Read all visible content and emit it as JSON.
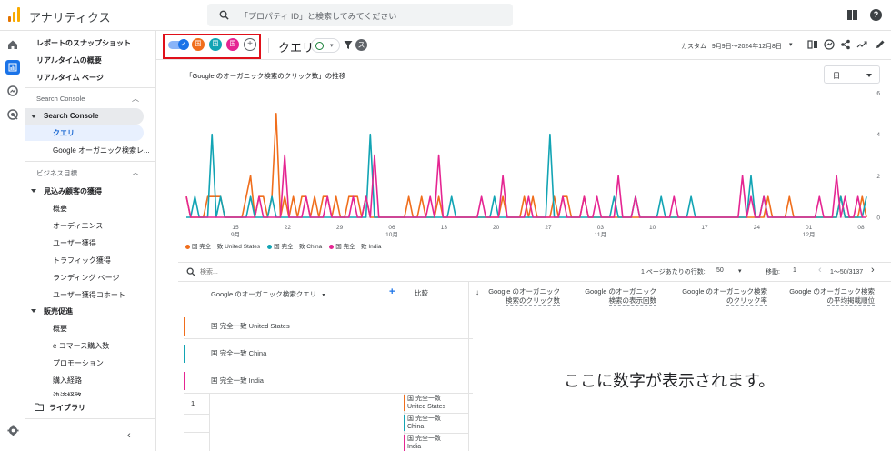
{
  "app": {
    "title": "アナリティクス"
  },
  "search": {
    "placeholder": "「プロパティ ID」と検索してみてください"
  },
  "nav": {
    "top_items": [
      "レポートのスナップショット",
      "リアルタイムの概要",
      "リアルタイム ページ"
    ],
    "section_search_console": "Search Console",
    "search_console_group": "Search Console",
    "search_console_children": [
      "クエリ",
      "Google オーガニック検索レ..."
    ],
    "section_business": "ビジネス目標",
    "acquisition_group": "見込み顧客の獲得",
    "acquisition_children": [
      "概要",
      "オーディエンス",
      "ユーザー獲得",
      "トラフィック獲得",
      "ランディング ページ",
      "ユーザー獲得コホート"
    ],
    "sales_group": "販売促進",
    "sales_children": [
      "概要",
      "e コマース購入数",
      "プロモーション",
      "購入経路",
      "決済経路"
    ],
    "library": "ライブラリ"
  },
  "toolbar": {
    "chips": [
      {
        "label": "国",
        "color": "#f06e1c"
      },
      {
        "label": "国",
        "color": "#12a4b4"
      },
      {
        "label": "国",
        "color": "#e52592"
      }
    ],
    "add": "+",
    "report_title": "クエリ",
    "s_badge": "ス",
    "date_prefix": "カスタム",
    "date_range": "9月9日～2024年12月8日"
  },
  "chart": {
    "title": "「Google のオーガニック検索のクリック数」の推移",
    "granularity": "日"
  },
  "chart_data": {
    "type": "line",
    "title": "「Google のオーガニック検索のクリック数」の推移",
    "ylim": [
      0,
      6
    ],
    "y_ticks": [
      "0",
      "2",
      "4",
      "6"
    ],
    "x_ticks": [
      {
        "day": "15",
        "month": "9月"
      },
      {
        "day": "22",
        "month": ""
      },
      {
        "day": "29",
        "month": ""
      },
      {
        "day": "06",
        "month": "10月"
      },
      {
        "day": "13",
        "month": ""
      },
      {
        "day": "20",
        "month": ""
      },
      {
        "day": "27",
        "month": ""
      },
      {
        "day": "03",
        "month": "11月"
      },
      {
        "day": "10",
        "month": ""
      },
      {
        "day": "17",
        "month": ""
      },
      {
        "day": "24",
        "month": ""
      },
      {
        "day": "01",
        "month": "12月"
      },
      {
        "day": "08",
        "month": ""
      }
    ],
    "series": [
      {
        "name": "国 完全一致 United States",
        "color": "#f06e1c",
        "values": [
          1,
          0,
          0,
          0,
          0,
          1,
          1,
          1,
          1,
          0,
          0,
          0,
          0,
          0,
          1,
          2,
          0,
          1,
          1,
          0,
          1,
          5,
          0,
          1,
          0,
          1,
          0,
          1,
          1,
          0,
          1,
          0,
          1,
          1,
          0,
          1,
          0,
          0,
          1,
          1,
          1,
          0,
          1,
          0,
          0,
          0,
          0,
          0,
          0,
          0,
          0,
          0,
          1,
          0,
          0,
          1,
          0,
          0,
          0,
          1,
          0,
          0,
          0,
          0,
          0,
          0,
          0,
          0,
          0,
          0,
          0,
          0,
          0,
          0,
          1,
          0,
          0,
          0,
          0,
          1,
          0,
          1,
          0,
          0,
          0,
          0,
          1,
          0,
          1,
          1,
          0,
          0,
          0,
          1,
          0,
          0,
          0,
          0,
          0,
          0,
          0,
          0,
          0,
          0,
          0,
          0,
          0,
          0,
          0,
          0,
          0,
          0,
          0,
          0,
          0,
          0,
          0,
          0,
          0,
          0,
          0,
          0,
          0,
          0,
          0,
          0,
          0,
          0,
          0,
          0,
          0,
          0,
          0,
          0,
          0,
          0,
          1,
          0,
          0,
          0,
          0,
          1,
          0,
          0,
          0,
          0,
          0,
          0,
          0,
          0,
          0,
          0,
          0,
          1,
          0,
          0,
          0,
          0,
          1,
          0
        ]
      },
      {
        "name": "国 完全一致 China",
        "color": "#12a4b4",
        "values": [
          0,
          0,
          1,
          0,
          0,
          0,
          4,
          0,
          1,
          0,
          0,
          0,
          0,
          0,
          0,
          1,
          0,
          0,
          0,
          0,
          1,
          0,
          0,
          0,
          0,
          0,
          0,
          0,
          0,
          0,
          0,
          0,
          0,
          0,
          0,
          0,
          0,
          0,
          0,
          0,
          0,
          0,
          0,
          4,
          0,
          0,
          0,
          0,
          0,
          0,
          0,
          0,
          0,
          0,
          0,
          0,
          0,
          0,
          0,
          0,
          0,
          0,
          1,
          0,
          0,
          0,
          0,
          0,
          0,
          0,
          0,
          0,
          1,
          0,
          0,
          0,
          0,
          0,
          0,
          0,
          0,
          0,
          0,
          0,
          0,
          4,
          0,
          0,
          0,
          0,
          0,
          0,
          0,
          0,
          0,
          0,
          0,
          0,
          0,
          0,
          1,
          0,
          0,
          0,
          0,
          1,
          0,
          0,
          0,
          0,
          0,
          1,
          0,
          0,
          0,
          0,
          0,
          0,
          1,
          0,
          0,
          0,
          0,
          0,
          0,
          0,
          0,
          0,
          0,
          0,
          0,
          0,
          2,
          0,
          0,
          1,
          0,
          0,
          0,
          0,
          0,
          0,
          0,
          0,
          0,
          0,
          0,
          0,
          0,
          0,
          0,
          0,
          0,
          1,
          0,
          0,
          0,
          0,
          0,
          1
        ]
      },
      {
        "name": "国 完全一致 India",
        "color": "#e52592",
        "values": [
          1,
          0,
          0,
          0,
          0,
          0,
          0,
          0,
          0,
          0,
          0,
          0,
          0,
          0,
          0,
          0,
          0,
          1,
          0,
          0,
          0,
          0,
          0,
          3,
          0,
          0,
          0,
          0,
          1,
          0,
          0,
          0,
          0,
          1,
          0,
          0,
          0,
          0,
          0,
          1,
          0,
          0,
          1,
          0,
          3,
          0,
          0,
          0,
          0,
          0,
          0,
          0,
          0,
          0,
          0,
          0,
          0,
          1,
          0,
          3,
          0,
          0,
          0,
          0,
          0,
          0,
          0,
          0,
          0,
          1,
          0,
          0,
          0,
          0,
          2,
          0,
          0,
          0,
          0,
          0,
          1,
          0,
          0,
          0,
          0,
          0,
          0,
          0,
          1,
          0,
          0,
          0,
          0,
          1,
          0,
          0,
          1,
          0,
          0,
          0,
          0,
          2,
          0,
          0,
          0,
          1,
          0,
          0,
          0,
          0,
          0,
          0,
          0,
          0,
          1,
          0,
          0,
          0,
          0,
          0,
          0,
          0,
          0,
          0,
          0,
          0,
          0,
          0,
          0,
          0,
          2,
          0,
          1,
          0,
          0,
          1,
          0,
          0,
          0,
          0,
          0,
          0,
          0,
          0,
          0,
          0,
          0,
          0,
          1,
          0,
          0,
          0,
          2,
          0,
          1,
          0,
          0,
          1,
          0,
          0
        ]
      }
    ]
  },
  "table": {
    "search_placeholder": "検索...",
    "rows_per_page_label": "1 ページあたりの行数:",
    "rows_per_page": "50",
    "move_label": "移動:",
    "move_value": "1",
    "range": "1～50/3137",
    "dim_header": "Google のオーガニック検索クエリ",
    "compare_header": "比較",
    "metrics": [
      [
        "Google のオーガニック",
        "検索のクリック数"
      ],
      [
        "Google のオーガニック",
        "検索の表示回数"
      ],
      [
        "Google のオーガニック検索",
        "のクリック率"
      ],
      [
        "Google のオーガニック検索",
        "の平均掲載順位"
      ]
    ],
    "segments": [
      {
        "label": "国 完全一致 United States",
        "color": "#f06e1c"
      },
      {
        "label": "国 完全一致 China",
        "color": "#12a4b4"
      },
      {
        "label": "国 完全一致 India",
        "color": "#e52592"
      }
    ],
    "row1_num": "1",
    "row1_segments": [
      {
        "l1": "国 完全一致",
        "l2": "United States",
        "color": "#f06e1c"
      },
      {
        "l1": "国 完全一致",
        "l2": "China",
        "color": "#12a4b4"
      },
      {
        "l1": "国 完全一致",
        "l2": "India",
        "color": "#e52592"
      }
    ]
  },
  "annotation": "ここに数字が表示されます。"
}
